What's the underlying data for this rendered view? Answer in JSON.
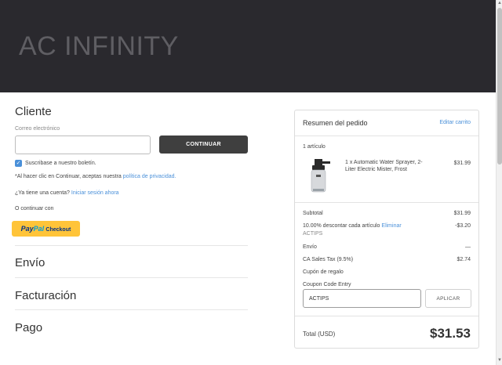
{
  "header": {
    "brand": "AC INFINITY"
  },
  "customer": {
    "title": "Cliente",
    "email_label": "Correo electrónico",
    "email_value": "",
    "continue_label": "CONTINUAR",
    "subscribe_label": "Suscribase a nuestro boletín.",
    "terms_prefix": "*Al hacer clic en Continuar, aceptas nuestra",
    "terms_link": "política de privacidad.",
    "account_prefix": "¿Ya tiene una cuenta?",
    "login_link": "Iniciar sesión ahora",
    "or_continue": "O continuar con",
    "paypal": {
      "pay": "Pay",
      "pal": "Pal",
      "checkout": "Checkout"
    }
  },
  "sections": {
    "shipping": "Envío",
    "billing": "Facturación",
    "payment": "Pago"
  },
  "summary": {
    "title": "Resumen del pedido",
    "edit_cart": "Editar carrito",
    "item_count": "1 artículo",
    "item": {
      "name_line1": "1 x Automatic Water Sprayer, 2-",
      "name_line2": "Liter Electric Mister, Frost",
      "price": "$31.99"
    },
    "subtotal_label": "Subtotal",
    "subtotal_value": "$31.99",
    "discount_label": "10.00% descontar cada artículo",
    "discount_remove": "Eliminar",
    "discount_code": "ACTIPS",
    "discount_value": "-$3.20",
    "shipping_label": "Envío",
    "shipping_value": "—",
    "tax_label": "CA Sales Tax (9.5%)",
    "tax_value": "$2.74",
    "gift_link": "Cupón de regalo",
    "coupon_label": "Coupon Code Entry",
    "coupon_value": "ACTIPS",
    "apply_label": "APLICAR",
    "total_label": "Total (USD)",
    "total_value": "$31.53"
  },
  "colors": {
    "header_bg": "#2a292e",
    "link": "#4a90d9",
    "paypal_yellow": "#ffc439",
    "button_dark": "#3f3f3f"
  }
}
